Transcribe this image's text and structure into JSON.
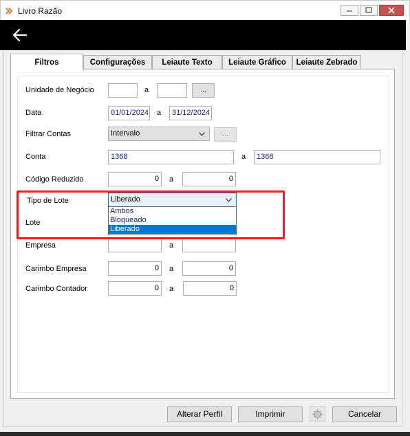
{
  "window": {
    "title": "Livro Razão",
    "minimize_label": "—",
    "maximize_label": "☐",
    "close_label": "✕"
  },
  "tabs": [
    {
      "label": "Filtros"
    },
    {
      "label": "Configurações"
    },
    {
      "label": "Leiaute Texto"
    },
    {
      "label": "Leiaute Gráfico"
    },
    {
      "label": "Leiaute Zebrado"
    }
  ],
  "form": {
    "unidade": {
      "label": "Unidade de Negócio",
      "from": "",
      "sep": "a",
      "to": "",
      "lookup": "..."
    },
    "data": {
      "label": "Data",
      "from": "01/01/2024",
      "sep": "a",
      "to": "31/12/2024"
    },
    "filtrar": {
      "label": "Filtrar Contas",
      "value": "Intervalo",
      "lookup": "..."
    },
    "conta": {
      "label": "Conta",
      "from": "1368",
      "sep": "a",
      "to": "1368"
    },
    "codigo": {
      "label": "Código Reduzido",
      "from": "0",
      "sep": "a",
      "to": "0"
    },
    "tipo_lote": {
      "label": "Tipo de Lote",
      "value": "Liberado",
      "options": [
        "Ambos",
        "Bloqueado",
        "Liberado"
      ]
    },
    "lote": {
      "label": "Lote"
    },
    "empresa": {
      "label": "Empresa",
      "sep": "a"
    },
    "carimbo_empresa": {
      "label": "Carimbo Empresa",
      "from": "0",
      "sep": "a",
      "to": "0"
    },
    "carimbo_contador": {
      "label": "Carimbo Contador",
      "from": "0",
      "sep": "a",
      "to": "0"
    }
  },
  "footer": {
    "alterar_perfil": "Alterar Perfil",
    "imprimir": "Imprimir",
    "cancelar": "Cancelar"
  },
  "colors": {
    "highlight": "#ee1c1c",
    "selected_option": "#0078d7",
    "field_text": "#1a237e"
  }
}
